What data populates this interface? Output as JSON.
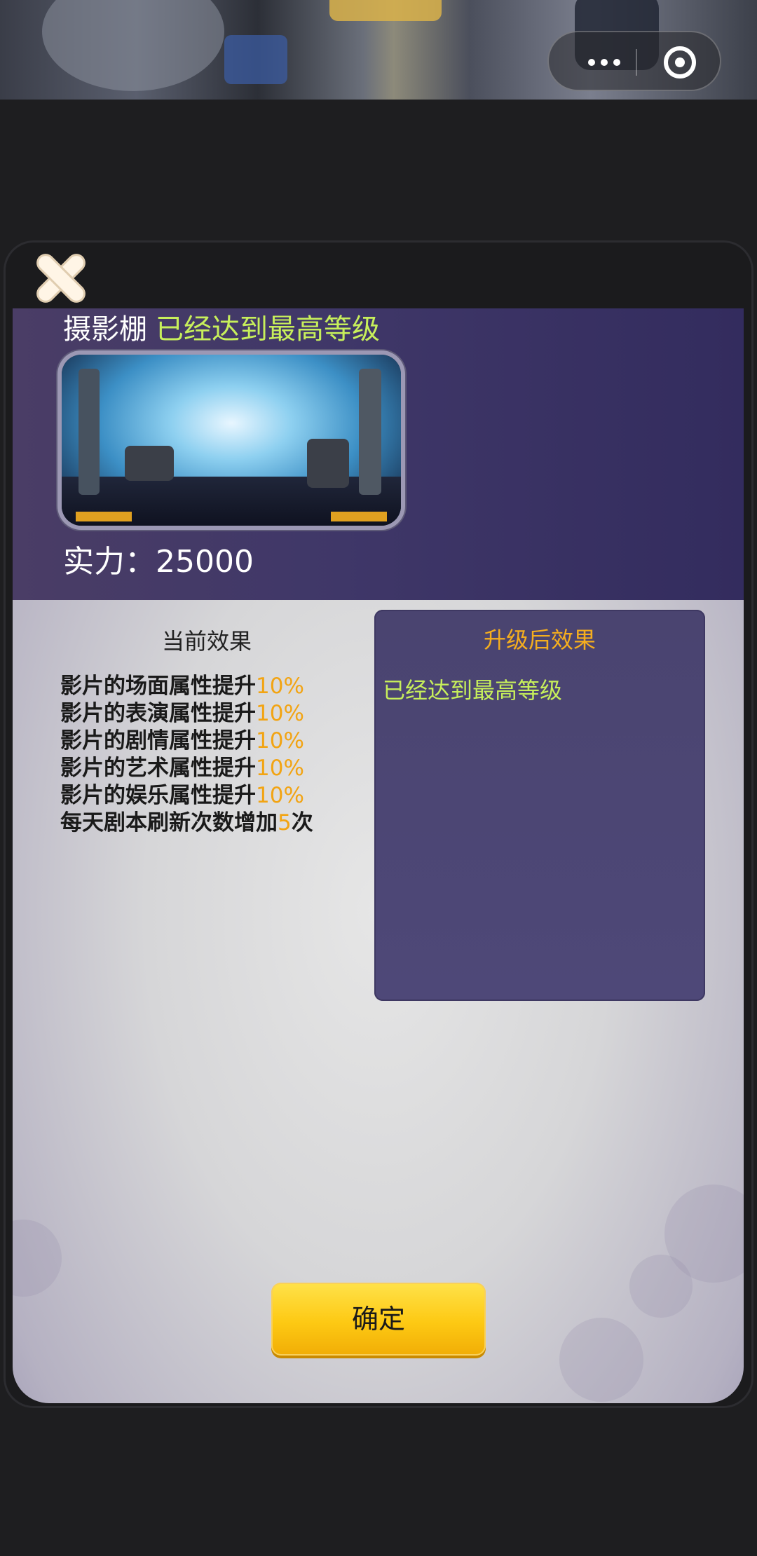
{
  "capsule": {
    "more_icon": "more-dots-icon",
    "close_icon": "target-circle-icon"
  },
  "dialog": {
    "close_icon": "close-x-icon",
    "building_name": "摄影棚",
    "status": "已经达到最高等级",
    "power_label": "实力：",
    "power_value": "25000",
    "current": {
      "title": "当前效果",
      "effects": [
        {
          "text": "影片的场面属性提升",
          "value": "10%"
        },
        {
          "text": "影片的表演属性提升",
          "value": "10%"
        },
        {
          "text": "影片的剧情属性提升",
          "value": "10%"
        },
        {
          "text": "影片的艺术属性提升",
          "value": "10%"
        },
        {
          "text": "影片的娱乐属性提升",
          "value": "10%"
        },
        {
          "text": "每天剧本刷新次数增加",
          "value": "5",
          "suffix": "次"
        }
      ]
    },
    "after": {
      "title": "升级后效果",
      "status": "已经达到最高等级"
    },
    "confirm_label": "确定"
  },
  "colors": {
    "accent_green": "#c7ef5b",
    "accent_orange": "#f2a413",
    "button_yellow": "#fdc913",
    "header_purple": "#3f3768"
  }
}
